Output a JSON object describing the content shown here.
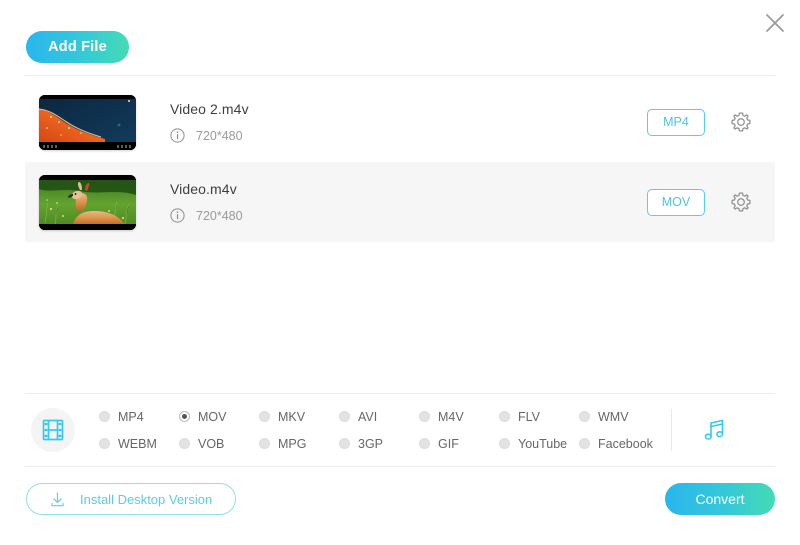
{
  "window": {
    "close_label": "close-icon"
  },
  "toolbar": {
    "add_file_label": "Add File"
  },
  "files": [
    {
      "name": "Video 2.m4v",
      "resolution": "720*480",
      "output_format": "MP4",
      "thumbnail": "aerial-coastline-night",
      "highlighted": false
    },
    {
      "name": "Video.m4v",
      "resolution": "720*480",
      "output_format": "MOV",
      "thumbnail": "deer-in-grass",
      "highlighted": true
    }
  ],
  "format_panel": {
    "category_icon": "film-strip-icon",
    "audio_icon": "music-note-icon",
    "options": [
      {
        "label": "MP4",
        "selected": false
      },
      {
        "label": "MOV",
        "selected": true
      },
      {
        "label": "MKV",
        "selected": false
      },
      {
        "label": "AVI",
        "selected": false
      },
      {
        "label": "M4V",
        "selected": false
      },
      {
        "label": "FLV",
        "selected": false
      },
      {
        "label": "WMV",
        "selected": false
      },
      {
        "label": "WEBM",
        "selected": false
      },
      {
        "label": "VOB",
        "selected": false
      },
      {
        "label": "MPG",
        "selected": false
      },
      {
        "label": "3GP",
        "selected": false
      },
      {
        "label": "GIF",
        "selected": false
      },
      {
        "label": "YouTube",
        "selected": false
      },
      {
        "label": "Facebook",
        "selected": false
      }
    ]
  },
  "footer": {
    "install_label": "Install Desktop Version",
    "convert_label": "Convert"
  },
  "colors": {
    "accent_start": "#2ab5ee",
    "accent_end": "#44dbb4",
    "badge_border": "#4cd3ef",
    "row_highlight": "#f6f6f6"
  }
}
